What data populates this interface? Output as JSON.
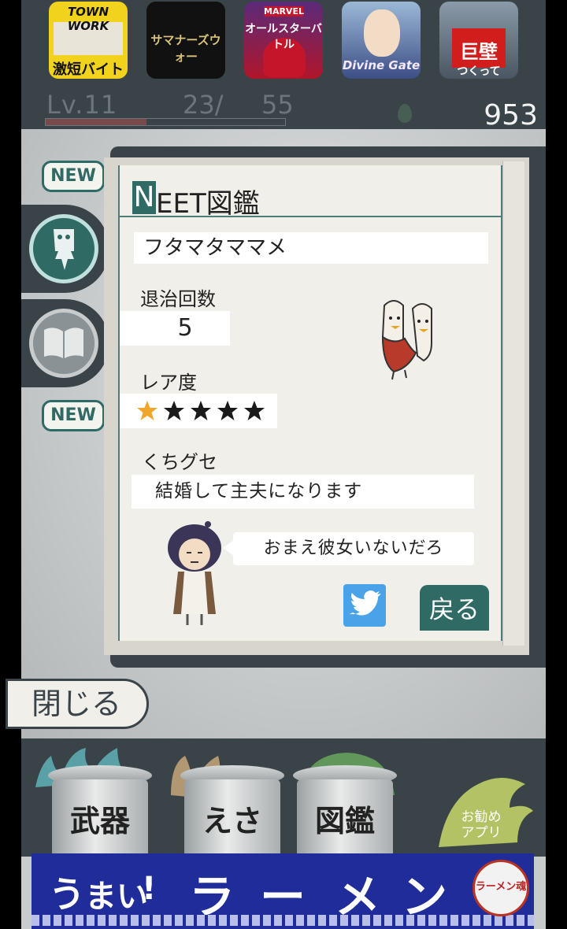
{
  "ads": [
    {
      "name": "townwork",
      "line1": "TOWN WORK",
      "line2": "激短バイト"
    },
    {
      "name": "summoners-war",
      "line1": "サマナーズウォー"
    },
    {
      "name": "marvel-battle",
      "line1": "MARVEL",
      "line2": "オールスターバトル"
    },
    {
      "name": "divine-gate",
      "line1": "Divine Gate"
    },
    {
      "name": "kyoheki",
      "line1": "巨壁",
      "line2": "つくって"
    }
  ],
  "status": {
    "level": "Lv.11",
    "exp_current": "23/",
    "exp_max": "55",
    "exp_ratio": 0.42,
    "coins": "953"
  },
  "side": {
    "new_top": "NEW",
    "new_bottom": "NEW"
  },
  "book": {
    "title_initial": "N",
    "title_rest": "EET図鑑",
    "name": "フタマタママメ",
    "count_label": "退治回数",
    "count": "5",
    "rarity_label": "レア度",
    "rarity": 1,
    "rarity_max": 5,
    "habit_label": "くちグセ",
    "habit": "結婚して主夫になります",
    "speech": "おまえ彼女いないだろ",
    "back": "戻る"
  },
  "close": "閉じる",
  "menu": [
    {
      "label": "武器"
    },
    {
      "label": "えさ"
    },
    {
      "label": "図鑑"
    }
  ],
  "recommend": {
    "line1": "お勧め",
    "line2": "アプリ"
  },
  "banner": {
    "chars": [
      "う",
      "ま",
      "い",
      "!",
      "ラ",
      "ー",
      "メ",
      "ン"
    ],
    "logo": "ラーメン魂"
  },
  "colors": {
    "accent": "#2f6a64",
    "dark": "#3a4348",
    "star_on": "#f0a52c",
    "star_off": "#1a1a1a",
    "twitter": "#4aa3e8",
    "banner": "#1f2c9a"
  }
}
